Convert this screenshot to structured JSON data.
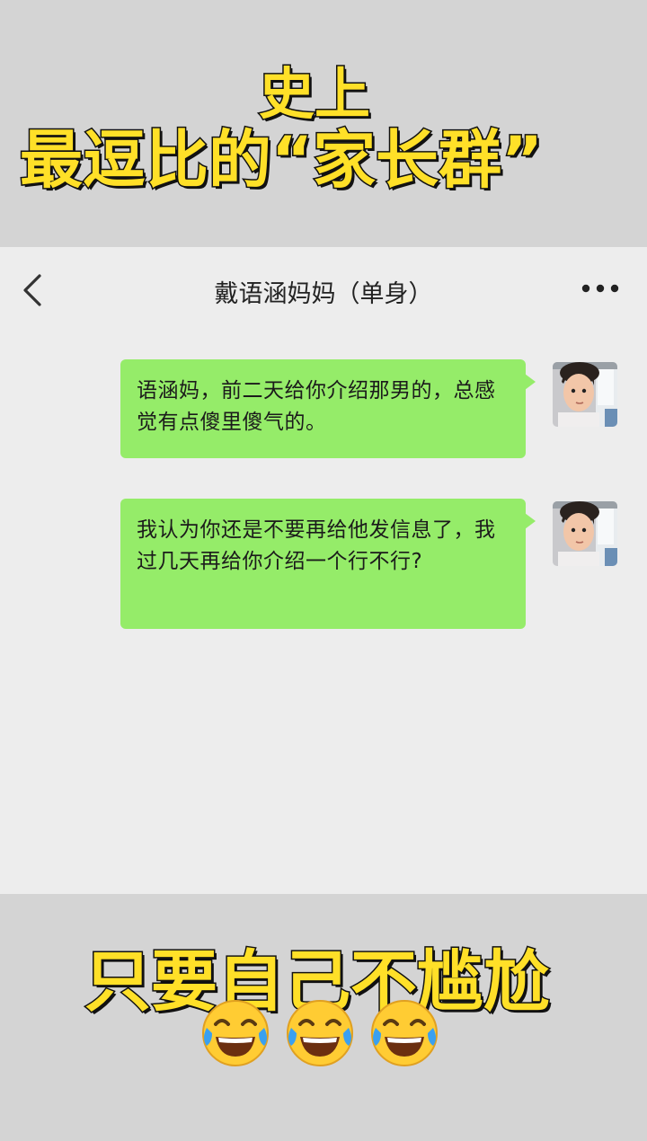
{
  "headline": {
    "line1": "史上",
    "line2": "最逗比的“家长群”"
  },
  "chat": {
    "title": "戴语涵妈妈（单身）",
    "back_icon": "chevron-left-icon",
    "more_icon": "more-dots-icon",
    "messages": [
      {
        "text": "语涵妈，前二天给你介绍那男的，总感觉有点傻里傻气的。"
      },
      {
        "text": "我认为你还是不要再给他发信息了，我过几天再给你介绍一个行不行?"
      }
    ]
  },
  "caption": {
    "text": "只要自己不尴尬",
    "emoji": "tears-of-joy-icon"
  },
  "colors": {
    "banner_bg": "#d4d4d4",
    "headline_fill": "#ffe028",
    "headline_outline": "#111111",
    "chat_bg": "#ededed",
    "bubble": "#95ec69"
  }
}
